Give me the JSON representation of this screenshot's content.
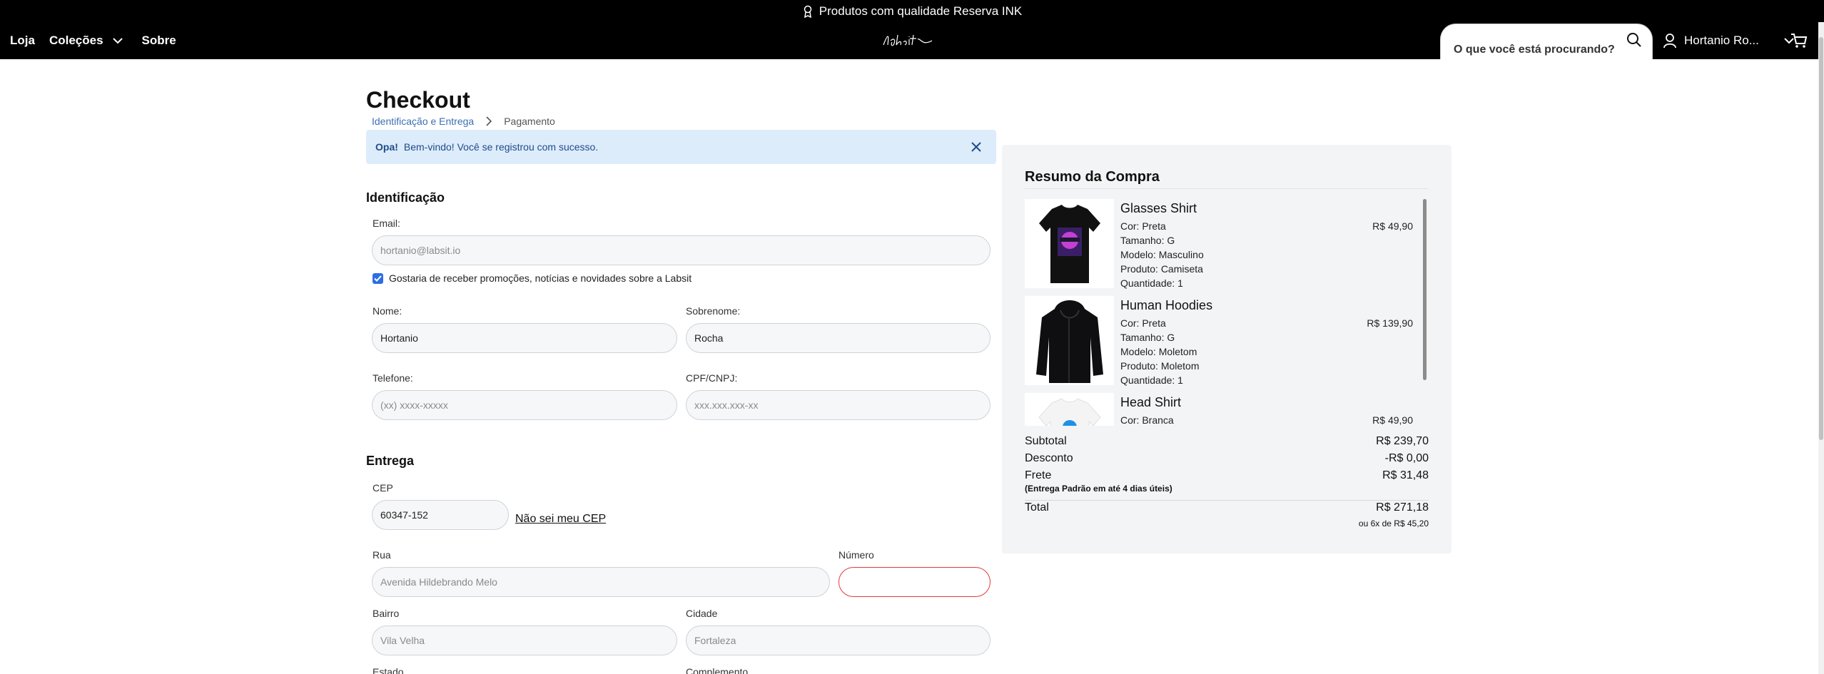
{
  "promo": {
    "text": "Produtos com qualidade Reserva INK",
    "icon": "award-icon"
  },
  "nav": {
    "items": [
      "Loja",
      "Coleções",
      "Sobre"
    ],
    "logo": "labsit",
    "search_placeholder": "O que você está procurando?",
    "user_name": "Hortanio Ro..."
  },
  "checkout": {
    "title": "Checkout",
    "breadcrumb": [
      "Identificação e Entrega",
      "Pagamento"
    ],
    "alert": {
      "strong": "Opa!",
      "message": "Bem-vindo! Você se registrou com sucesso."
    },
    "identificacao": {
      "title": "Identificação",
      "email_label": "Email:",
      "email_value": "hortanio@labsit.io",
      "newsletter_label": "Gostaria de receber promoções, notícias e novidades sobre a Labsit",
      "newsletter_checked": true,
      "nome_label": "Nome:",
      "nome_value": "Hortanio",
      "sobrenome_label": "Sobrenome:",
      "sobrenome_value": "Rocha",
      "telefone_label": "Telefone:",
      "telefone_placeholder": "(xx) xxxx-xxxxx",
      "cpf_label": "CPF/CNPJ:",
      "cpf_placeholder": "xxx.xxx.xxx-xx"
    },
    "entrega": {
      "title": "Entrega",
      "cep_label": "CEP",
      "cep_value": "60347-152",
      "cep_link": "Não sei meu CEP",
      "rua_label": "Rua",
      "rua_value": "Avenida Hildebrando Melo",
      "numero_label": "Número",
      "numero_value": "",
      "bairro_label": "Bairro",
      "bairro_value": "Vila Velha",
      "cidade_label": "Cidade",
      "cidade_value": "Fortaleza",
      "estado_label": "Estado",
      "complemento_label": "Complemento"
    }
  },
  "summary": {
    "title": "Resumo da Compra",
    "items": [
      {
        "name": "Glasses Shirt",
        "price": "R$ 49,90",
        "attrs": [
          "Cor: Preta",
          "Tamanho: G",
          "Modelo: Masculino",
          "Produto: Camiseta",
          "Quantidade: 1"
        ]
      },
      {
        "name": "Human Hoodies",
        "price": "R$ 139,90",
        "attrs": [
          "Cor: Preta",
          "Tamanho: G",
          "Modelo: Moletom",
          "Produto: Moletom",
          "Quantidade: 1"
        ]
      },
      {
        "name": "Head Shirt",
        "price": "R$ 49,90",
        "attrs": [
          "Cor: Branca"
        ]
      }
    ],
    "subtotal_label": "Subtotal",
    "subtotal_value": "R$ 239,70",
    "desconto_label": "Desconto",
    "desconto_value": "-R$ 0,00",
    "frete_label": "Frete",
    "frete_value": "R$ 31,48",
    "frete_note": "(Entrega Padrão em até 4 dias úteis)",
    "total_label": "Total",
    "total_value": "R$ 271,18",
    "installments": "ou 6x de R$ 45,20"
  }
}
